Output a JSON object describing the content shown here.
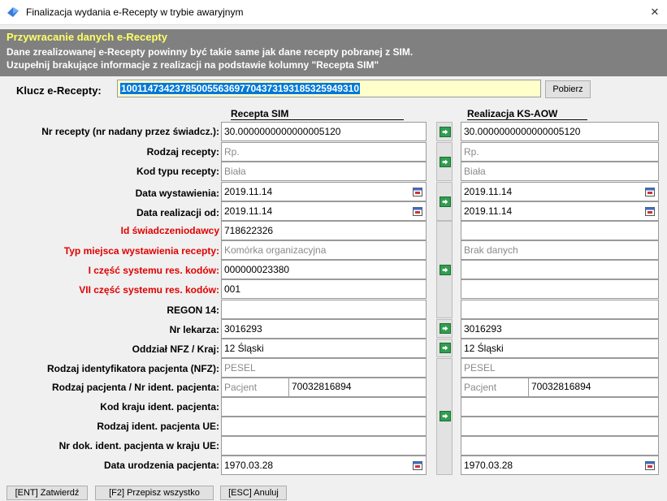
{
  "window": {
    "title": "Finalizacja wydania e-Recepty w trybie awaryjnym",
    "close_glyph": "✕"
  },
  "banner": {
    "heading": "Przywracanie danych e-Recepty",
    "line1": "Dane zrealizowanej e-Recepty powinny być takie same jak dane recepty pobranej z SIM.",
    "line2": "Uzupełnij brakujące informacje z realizacji na podstawie kolumny \"Recepta SIM\""
  },
  "key": {
    "label": "Klucz e-Recepty:",
    "value": "1001147342378500556369770437319318532594931​0",
    "fetch_button": "Pobierz"
  },
  "columns": {
    "sim": "Recepta SIM",
    "ks": "Realizacja KS-AOW"
  },
  "rows": [
    {
      "label": "Nr recepty (nr nadany przez świadcz.):",
      "sim": "30.0000000000000005120",
      "ks": "30.0000000000000005120"
    },
    {
      "label": "Rodzaj recepty:",
      "sim": "Rp.",
      "ks": "Rp."
    },
    {
      "label": "Kod typu recepty:",
      "sim": "Biała",
      "ks": "Biała"
    },
    {
      "label": "Data wystawienia:",
      "sim": "2019.11.14",
      "ks": "2019.11.14"
    },
    {
      "label": "Data realizacji od:",
      "sim": "2019.11.14",
      "ks": "2019.11.14"
    },
    {
      "label": "Id świadczeniodawcy",
      "sim": "718622326",
      "ks": ""
    },
    {
      "label": "Typ miejsca wystawienia recepty:",
      "sim": "Komórka organizacyjna",
      "ks": "Brak danych"
    },
    {
      "label": "I część systemu res. kodów:",
      "sim": "000000023380",
      "ks": ""
    },
    {
      "label": "VII część systemu res. kodów:",
      "sim": "001",
      "ks": ""
    },
    {
      "label": "REGON 14:",
      "sim": "",
      "ks": ""
    },
    {
      "label": "Nr lekarza:",
      "sim": "3016293",
      "ks": "3016293"
    },
    {
      "label": "Oddział NFZ / Kraj:",
      "sim": "12 Śląski",
      "ks": "12 Śląski"
    },
    {
      "label": "Rodzaj identyfikatora pacjenta (NFZ):",
      "sim": "PESEL",
      "ks": "PESEL"
    },
    {
      "label": "Rodzaj pacjenta / Nr ident. pacjenta:",
      "sim": "Pacjent",
      "sim2": "70032816894",
      "ks": "Pacjent",
      "ks2": "70032816894"
    },
    {
      "label": "Kod kraju ident. pacjenta:",
      "sim": "",
      "ks": ""
    },
    {
      "label": "Rodzaj  ident. pacjenta UE:",
      "sim": "",
      "ks": ""
    },
    {
      "label": "Nr dok. ident. pacjenta w kraju UE:",
      "sim": "",
      "ks": ""
    },
    {
      "label": "Data urodzenia pacjenta:",
      "sim": "1970.03.28",
      "ks": "1970.03.28"
    }
  ],
  "footer": {
    "confirm": "[ENT] Zatwierdź",
    "copy_all": "[F2] Przepisz wszystko",
    "cancel": "[ESC] Anuluj"
  },
  "colors": {
    "banner_bg": "#808080",
    "banner_heading": "#ffff66",
    "key_bg": "#ffffcc",
    "selection": "#0078d7",
    "required_label": "#e00000",
    "arrow_green": "#2f9e4f"
  }
}
